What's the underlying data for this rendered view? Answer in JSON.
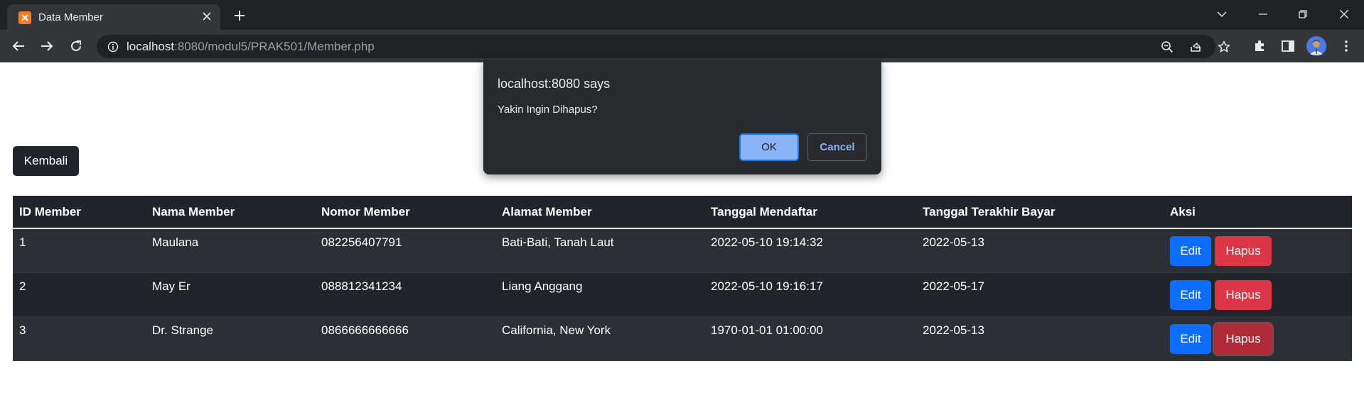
{
  "browser": {
    "tab_title": "Data Member",
    "url_host": "localhost",
    "url_rest": ":8080/modul5/PRAK501/Member.php",
    "tab_close_icon": "close-icon",
    "new_tab_icon": "plus-icon"
  },
  "page": {
    "back_label": "Kembali",
    "table": {
      "headers": [
        "ID Member",
        "Nama Member",
        "Nomor Member",
        "Alamat Member",
        "Tanggal Mendaftar",
        "Tanggal Terakhir Bayar",
        "Aksi"
      ],
      "rows": [
        {
          "id": "1",
          "nama": "Maulana",
          "nomor": "082256407791",
          "alamat": "Bati-Bati, Tanah Laut",
          "tgl_daftar": "2022-05-10 19:14:32",
          "tgl_bayar": "2022-05-13",
          "edit": "Edit",
          "hapus": "Hapus"
        },
        {
          "id": "2",
          "nama": "May Er",
          "nomor": "088812341234",
          "alamat": "Liang Anggang",
          "tgl_daftar": "2022-05-10 19:16:17",
          "tgl_bayar": "2022-05-17",
          "edit": "Edit",
          "hapus": "Hapus"
        },
        {
          "id": "3",
          "nama": "Dr. Strange",
          "nomor": "0866666666666",
          "alamat": "California, New York",
          "tgl_daftar": "1970-01-01 01:00:00",
          "tgl_bayar": "2022-05-13",
          "edit": "Edit",
          "hapus": "Hapus"
        }
      ]
    }
  },
  "dialog": {
    "title": "localhost:8080 says",
    "message": "Yakin Ingin Dihapus?",
    "ok_label": "OK",
    "cancel_label": "Cancel"
  },
  "colors": {
    "table_bg": "#212529",
    "table_striped": "#2c3034",
    "edit_btn": "#0d6efd",
    "hapus_btn": "#dc3545",
    "dialog_bg": "#292a2d",
    "dialog_accent": "#8ab4f8"
  }
}
